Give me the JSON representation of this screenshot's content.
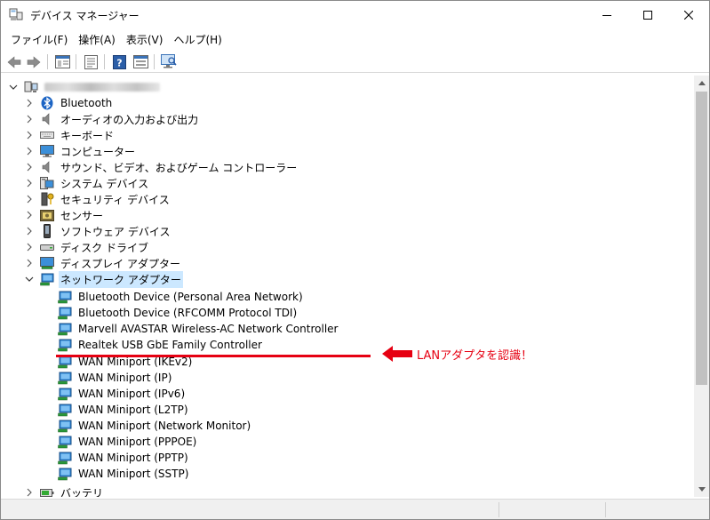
{
  "window": {
    "title": "デバイス マネージャー"
  },
  "menu": [
    "ファイル(F)",
    "操作(A)",
    "表示(V)",
    "ヘルプ(H)"
  ],
  "toolbar": {
    "buttons": [
      "back-icon",
      "forward-icon",
      "view-tree-icon",
      "properties-icon",
      "help-icon",
      "details-icon",
      "monitor-scan-icon"
    ]
  },
  "tree": {
    "root_label": "DESKTOP-XXXXXXX",
    "categories": [
      "Bluetooth",
      "オーディオの入力および出力",
      "キーボード",
      "コンピューター",
      "サウンド、ビデオ、およびゲーム コントローラー",
      "システム デバイス",
      "セキュリティ デバイス",
      "センサー",
      "ソフトウェア デバイス",
      "ディスク ドライブ",
      "ディスプレイ アダプター",
      "ネットワーク アダプター"
    ],
    "network_adapters": [
      "Bluetooth Device (Personal Area Network)",
      "Bluetooth Device (RFCOMM Protocol TDI)",
      "Marvell AVASTAR Wireless-AC Network Controller",
      "Realtek USB GbE Family Controller",
      "WAN Miniport (IKEv2)",
      "WAN Miniport (IP)",
      "WAN Miniport (IPv6)",
      "WAN Miniport (L2TP)",
      "WAN Miniport (Network Monitor)",
      "WAN Miniport (PPPOE)",
      "WAN Miniport (PPTP)",
      "WAN Miniport (SSTP)"
    ],
    "next_category": "バッテリ"
  },
  "annotation": {
    "text": "LANアダプタを認識！",
    "color": "#e60012"
  },
  "colors": {
    "selection": "#cce8ff",
    "network_icon": "#1f7fd0"
  }
}
